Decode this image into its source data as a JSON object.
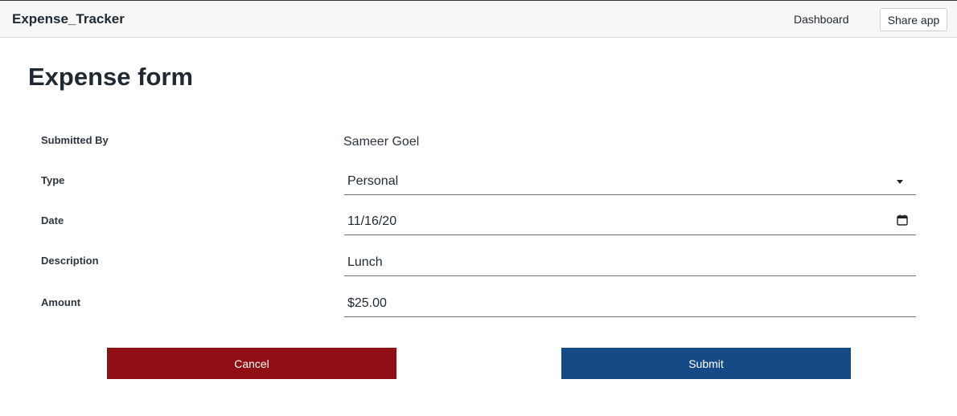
{
  "navbar": {
    "brand": "Expense_Tracker",
    "dashboard_link": "Dashboard",
    "share_button": "Share app"
  },
  "page": {
    "title": "Expense form"
  },
  "form": {
    "submitted_by": {
      "label": "Submitted By",
      "value": "Sameer Goel"
    },
    "type": {
      "label": "Type",
      "value": "Personal"
    },
    "date": {
      "label": "Date",
      "value": "11/16/20"
    },
    "description": {
      "label": "Description",
      "value": "Lunch"
    },
    "amount": {
      "label": "Amount",
      "value": "$25.00"
    }
  },
  "buttons": {
    "cancel": "Cancel",
    "submit": "Submit"
  },
  "colors": {
    "cancel_bg": "#8f0f14",
    "submit_bg": "#164a87",
    "navbar_bg": "#f7f7f7"
  },
  "icons": {
    "type_dropdown": "chevron-down-icon",
    "date_picker": "calendar-icon"
  }
}
